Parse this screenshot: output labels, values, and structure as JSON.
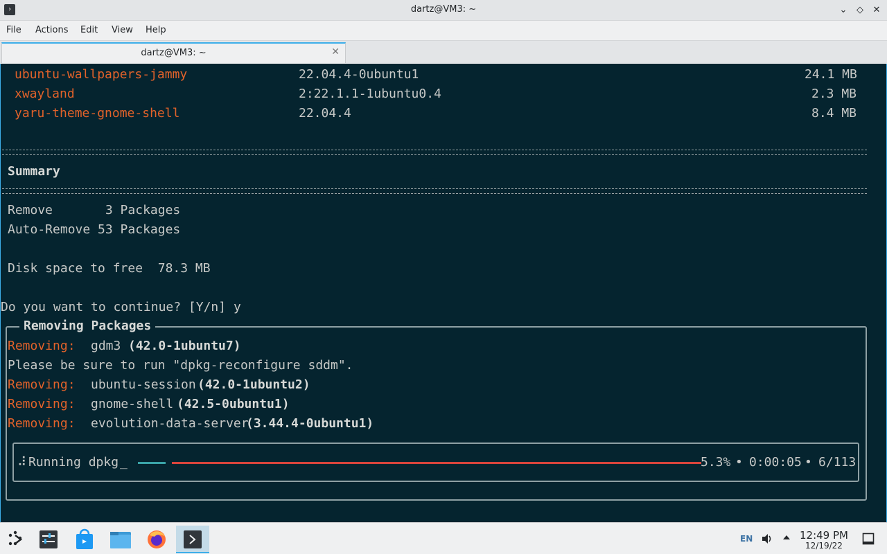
{
  "window": {
    "title": "dartz@VM3: ~",
    "icon": "terminal-icon",
    "controls": [
      "minimize",
      "maximize",
      "close"
    ]
  },
  "menubar": {
    "items": [
      "File",
      "Actions",
      "Edit",
      "View",
      "Help"
    ]
  },
  "tabs": [
    {
      "label": "dartz@VM3: ~",
      "active": true
    }
  ],
  "terminal": {
    "packages": [
      {
        "name": "ubuntu-wallpapers-jammy",
        "version": "22.04.4-0ubuntu1",
        "size": "24.1 MB"
      },
      {
        "name": "xwayland",
        "version": "2:22.1.1-1ubuntu0.4",
        "size": "2.3 MB"
      },
      {
        "name": "yaru-theme-gnome-shell",
        "version": "22.04.4",
        "size": "8.4 MB"
      }
    ],
    "summary_title": "Summary",
    "summary": {
      "remove": "Remove       3 Packages",
      "auto_remove": "Auto-Remove 53 Packages",
      "disk_space": "Disk space to free  78.3 MB"
    },
    "prompt": "Do you want to continue? [Y/n] y",
    "panel_title": "Removing Packages",
    "removing": [
      {
        "label": "Removing:",
        "pkg": "gdm3",
        "ver": "(42.0-1ubuntu7)"
      },
      {
        "note": "Please be sure to run \"dpkg-reconfigure sddm\"."
      },
      {
        "label": "Removing:",
        "pkg": "ubuntu-session",
        "ver": "(42.0-1ubuntu2)"
      },
      {
        "label": "Removing:",
        "pkg": "gnome-shell",
        "ver": "(42.5-0ubuntu1)"
      },
      {
        "label": "Removing:",
        "pkg": "evolution-data-server",
        "ver": "(3.44.4-0ubuntu1)"
      }
    ],
    "progress": {
      "label": "Running dpkg",
      "percent_text": "5.3%",
      "percent": 5.3,
      "elapsed": "0:00:05",
      "count": "6/113"
    }
  },
  "taskbar": {
    "apps": [
      "application-launcher-icon",
      "system-settings-icon",
      "discover-store-icon",
      "file-manager-icon",
      "firefox-icon",
      "terminal-icon"
    ],
    "language": "EN",
    "time": "12:49 PM",
    "date": "12/19/22"
  },
  "colors": {
    "terminal_bg": "#05242f",
    "accent": "#3daee9",
    "orange": "#e2622a",
    "progress_red": "#d9453c",
    "progress_cyan": "#3aa4a8"
  }
}
